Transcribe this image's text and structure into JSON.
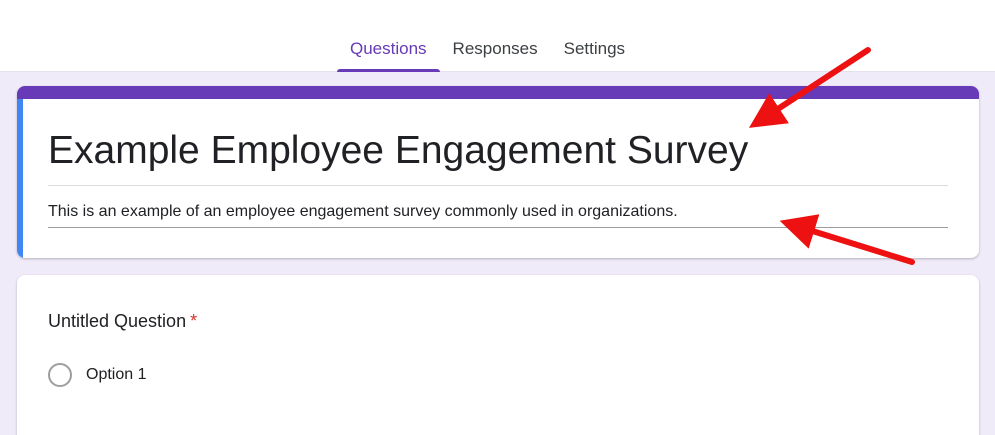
{
  "tabs": [
    {
      "label": "Questions",
      "active": true
    },
    {
      "label": "Responses",
      "active": false
    },
    {
      "label": "Settings",
      "active": false
    }
  ],
  "form": {
    "title": "Example Employee Engagement Survey",
    "description": "This is an example of an employee engagement survey commonly used in organizations."
  },
  "question": {
    "title": "Untitled Question",
    "required_mark": "*",
    "options": [
      "Option 1"
    ]
  },
  "colors": {
    "accent": "#673ab7",
    "focus_left": "#4285f4",
    "required": "#d93025",
    "annotation_arrow": "#ee1111",
    "background": "#f0ebf8"
  },
  "icons": {
    "annotation": "red-arrow-icon",
    "radio": "radio-unchecked-icon"
  }
}
